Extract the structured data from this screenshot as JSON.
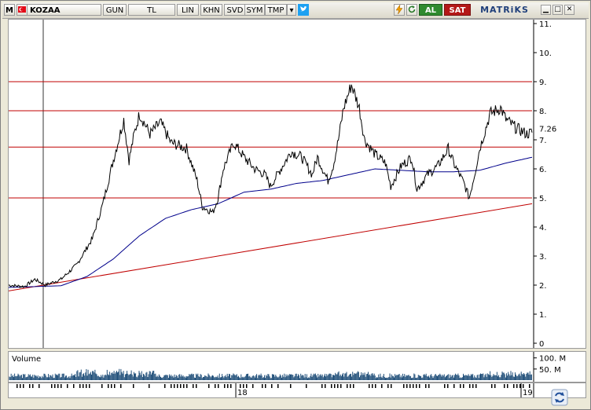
{
  "toolbar": {
    "logo": "M",
    "symbol": "KOZAA",
    "period": "GUN",
    "currency": "TL",
    "buttons": [
      "LIN",
      "KHN",
      "SVD",
      "SYM",
      "TMP"
    ],
    "buy_label": "AL",
    "sell_label": "SAT",
    "brand": "MATRiKS",
    "icons": [
      "flag-icon",
      "dropdown-arrow-icon",
      "twitter-icon",
      "lightning-icon",
      "refresh-icon",
      "minimize-icon",
      "maximize-icon",
      "close-icon"
    ]
  },
  "colors": {
    "price": "#000000",
    "moving_average": "#00008b",
    "levels": "#c00000",
    "trendline": "#c00000",
    "volume": "#1f4e79",
    "buy": "#2f8a2f",
    "sell": "#b41818"
  },
  "chart_data": {
    "type": "line",
    "symbol": "KOZAA",
    "y_ticks": [
      "0",
      "1.",
      "2.",
      "3.",
      "4.",
      "5.",
      "6.",
      "7.",
      "8.",
      "9.",
      "10.",
      "11."
    ],
    "ylim": [
      0,
      11
    ],
    "last_value_label": "7.26",
    "horizontal_levels": [
      5.0,
      6.75,
      8.0,
      9.0
    ],
    "trendline": {
      "start": 1.8,
      "end": 4.8
    },
    "x_labels": [
      "18",
      "19"
    ],
    "price_keypoints": [
      [
        0,
        2.0
      ],
      [
        0.03,
        1.95
      ],
      [
        0.05,
        2.2
      ],
      [
        0.07,
        2.0
      ],
      [
        0.1,
        2.2
      ],
      [
        0.13,
        2.7
      ],
      [
        0.16,
        3.6
      ],
      [
        0.18,
        4.8
      ],
      [
        0.2,
        6.3
      ],
      [
        0.22,
        7.7
      ],
      [
        0.23,
        6.3
      ],
      [
        0.24,
        7.2
      ],
      [
        0.25,
        7.9
      ],
      [
        0.27,
        7.2
      ],
      [
        0.29,
        7.6
      ],
      [
        0.31,
        6.9
      ],
      [
        0.34,
        6.7
      ],
      [
        0.36,
        5.6
      ],
      [
        0.37,
        4.7
      ],
      [
        0.39,
        4.5
      ],
      [
        0.4,
        5.0
      ],
      [
        0.41,
        6.0
      ],
      [
        0.43,
        6.9
      ],
      [
        0.45,
        6.4
      ],
      [
        0.47,
        6.0
      ],
      [
        0.49,
        5.8
      ],
      [
        0.5,
        5.4
      ],
      [
        0.52,
        6.0
      ],
      [
        0.54,
        6.6
      ],
      [
        0.56,
        6.4
      ],
      [
        0.58,
        5.8
      ],
      [
        0.59,
        6.4
      ],
      [
        0.61,
        5.6
      ],
      [
        0.62,
        6.1
      ],
      [
        0.63,
        7.0
      ],
      [
        0.64,
        8.1
      ],
      [
        0.655,
        8.9
      ],
      [
        0.67,
        8.1
      ],
      [
        0.68,
        7.0
      ],
      [
        0.7,
        6.5
      ],
      [
        0.72,
        6.2
      ],
      [
        0.73,
        5.4
      ],
      [
        0.75,
        6.1
      ],
      [
        0.77,
        6.4
      ],
      [
        0.78,
        5.3
      ],
      [
        0.8,
        5.8
      ],
      [
        0.82,
        6.1
      ],
      [
        0.84,
        6.7
      ],
      [
        0.85,
        6.2
      ],
      [
        0.87,
        5.5
      ],
      [
        0.88,
        5.0
      ],
      [
        0.89,
        5.8
      ],
      [
        0.9,
        6.7
      ],
      [
        0.92,
        7.9
      ],
      [
        0.94,
        8.1
      ],
      [
        0.95,
        7.7
      ],
      [
        0.97,
        7.4
      ],
      [
        0.99,
        7.2
      ],
      [
        1.0,
        7.26
      ]
    ],
    "ma_keypoints": [
      [
        0,
        1.92
      ],
      [
        0.1,
        1.98
      ],
      [
        0.15,
        2.3
      ],
      [
        0.2,
        2.9
      ],
      [
        0.25,
        3.7
      ],
      [
        0.3,
        4.3
      ],
      [
        0.35,
        4.6
      ],
      [
        0.4,
        4.8
      ],
      [
        0.45,
        5.2
      ],
      [
        0.5,
        5.3
      ],
      [
        0.55,
        5.5
      ],
      [
        0.6,
        5.6
      ],
      [
        0.65,
        5.8
      ],
      [
        0.7,
        6.0
      ],
      [
        0.75,
        5.95
      ],
      [
        0.8,
        5.9
      ],
      [
        0.85,
        5.9
      ],
      [
        0.9,
        5.95
      ],
      [
        0.95,
        6.2
      ],
      [
        1.0,
        6.4
      ]
    ],
    "volume": {
      "label": "Volume",
      "y_ticks": [
        "100. M",
        "50. M"
      ],
      "ylim": [
        0,
        120
      ]
    }
  }
}
